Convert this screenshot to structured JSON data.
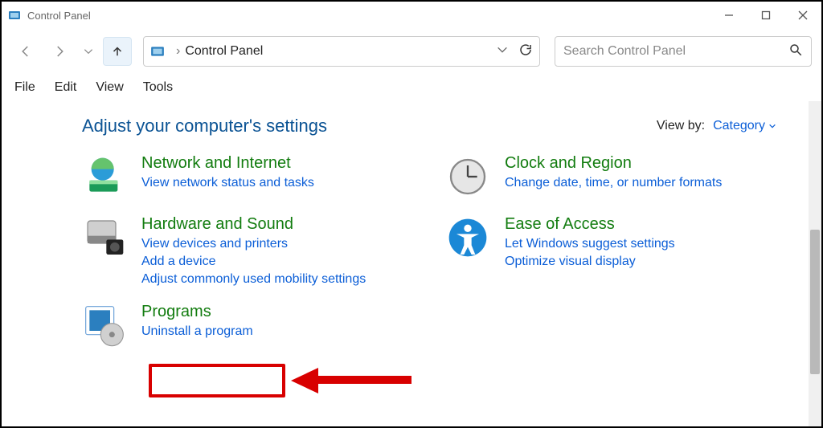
{
  "window": {
    "title": "Control Panel"
  },
  "nav": {
    "breadcrumb_caret": "›",
    "breadcrumb": "Control Panel"
  },
  "search": {
    "placeholder": "Search Control Panel"
  },
  "menu": {
    "file": "File",
    "edit": "Edit",
    "view": "View",
    "tools": "Tools"
  },
  "page": {
    "heading": "Adjust your computer's settings",
    "viewby_label": "View by:",
    "viewby_value": "Category"
  },
  "categories": {
    "network": {
      "title": "Network and Internet",
      "links": [
        "View network status and tasks"
      ]
    },
    "hardware": {
      "title": "Hardware and Sound",
      "links": [
        "View devices and printers",
        "Add a device",
        "Adjust commonly used mobility settings"
      ]
    },
    "programs": {
      "title": "Programs",
      "links": [
        "Uninstall a program"
      ]
    },
    "clock": {
      "title": "Clock and Region",
      "links": [
        "Change date, time, or number formats"
      ]
    },
    "ease": {
      "title": "Ease of Access",
      "links": [
        "Let Windows suggest settings",
        "Optimize visual display"
      ]
    }
  }
}
